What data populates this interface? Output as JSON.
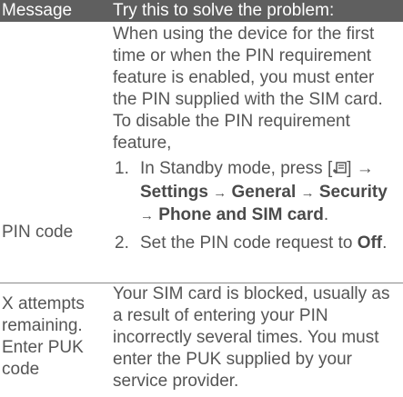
{
  "header": {
    "message_label": "Message",
    "solution_label": "Try this to solve the problem:"
  },
  "rows": [
    {
      "message": "PIN code",
      "intro": "When using the device for the first time or when the PIN requirement feature is enabled, you must enter the PIN supplied with the SIM card. To disable the PIN requirement feature,",
      "steps": [
        {
          "num": "1.",
          "pre": "In Standby mode, press [",
          "icon": "menu-key-icon",
          "post": "] →",
          "path": [
            "Settings",
            "General",
            "Security",
            "Phone and SIM card"
          ],
          "path_sep": "→",
          "end": "."
        },
        {
          "num": "2.",
          "pre": "Set the PIN code request to ",
          "bold": "Off",
          "end": "."
        }
      ]
    },
    {
      "message": "X attempts remaining. Enter PUK code",
      "text": "Your SIM card is blocked, usually as a result of entering your PIN incorrectly several times. You must enter the PUK supplied by your service provider."
    }
  ],
  "colors": {
    "header_bg": "#5f5f5f",
    "header_text": "#ffffff",
    "body_text": "#555555",
    "separator": "#8a8a8a"
  }
}
